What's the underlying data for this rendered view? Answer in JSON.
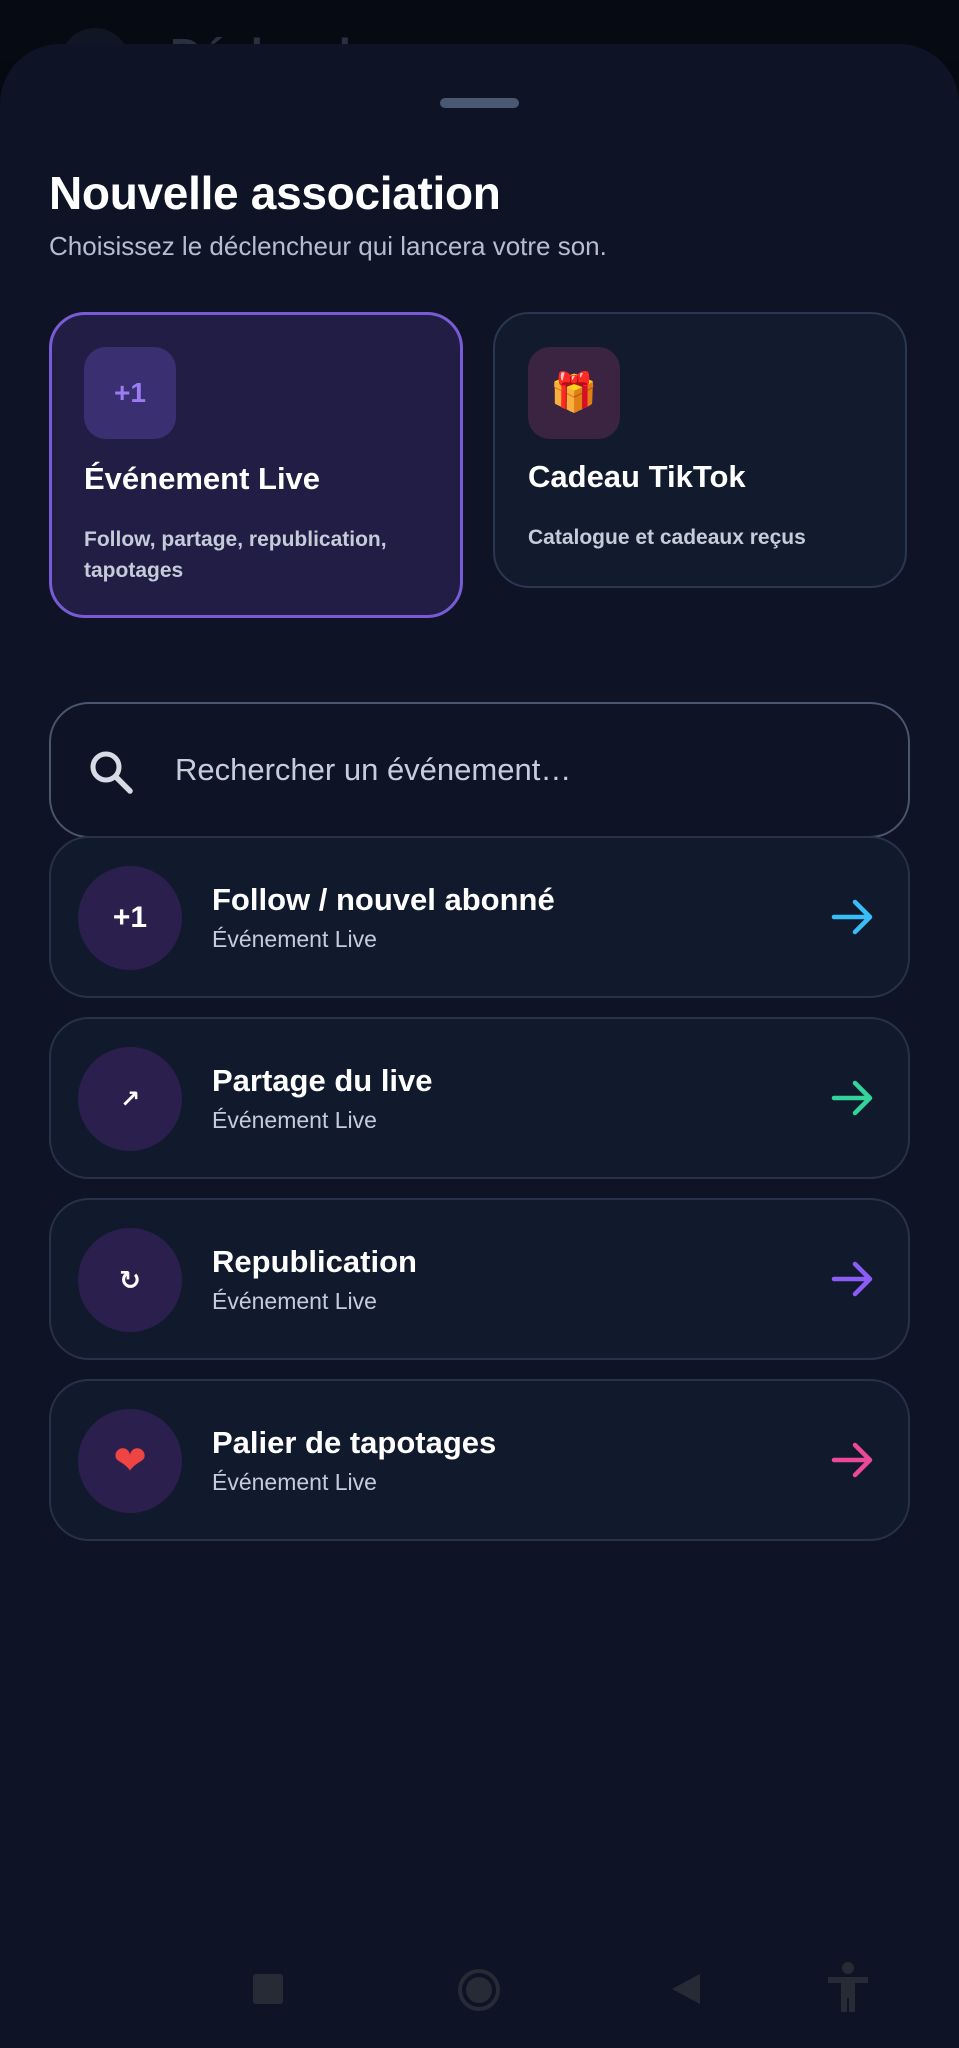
{
  "background_screen": {
    "title": "Déclencheurs"
  },
  "sheet": {
    "title": "Nouvelle association",
    "subtitle": "Choisissez le déclencheur qui lancera votre son."
  },
  "trigger_types": [
    {
      "icon": "+1",
      "icon_name": "plus-one-icon",
      "name": "Événement Live",
      "description": "Follow, partage, republication, tapotages",
      "selected": true
    },
    {
      "icon": "🎁",
      "icon_name": "gift-icon",
      "name": "Cadeau TikTok",
      "description": "Catalogue et cadeaux reçus",
      "selected": false
    }
  ],
  "search": {
    "placeholder": "Rechercher un événement…",
    "value": ""
  },
  "events": [
    {
      "icon": "+1",
      "icon_name": "plus-one-icon",
      "name": "Follow / nouvel abonné",
      "category": "Événement Live",
      "arrow_color": "#38bdf8"
    },
    {
      "icon": "↗",
      "icon_name": "share-arrow-icon",
      "name": "Partage du live",
      "category": "Événement Live",
      "arrow_color": "#34d399"
    },
    {
      "icon": "↻",
      "icon_name": "repost-icon",
      "name": "Republication",
      "category": "Événement Live",
      "arrow_color": "#8b5cf6"
    },
    {
      "icon": "❤",
      "icon_name": "heart-icon",
      "name": "Palier de tapotages",
      "category": "Événement Live",
      "arrow_color": "#ec4899"
    }
  ],
  "colors": {
    "accent": "#7a5bd6",
    "sheet_background": "#0e1425",
    "heart": "#ef4444"
  },
  "system_nav": [
    "recents-button",
    "home-button",
    "back-button",
    "accessibility-button"
  ]
}
